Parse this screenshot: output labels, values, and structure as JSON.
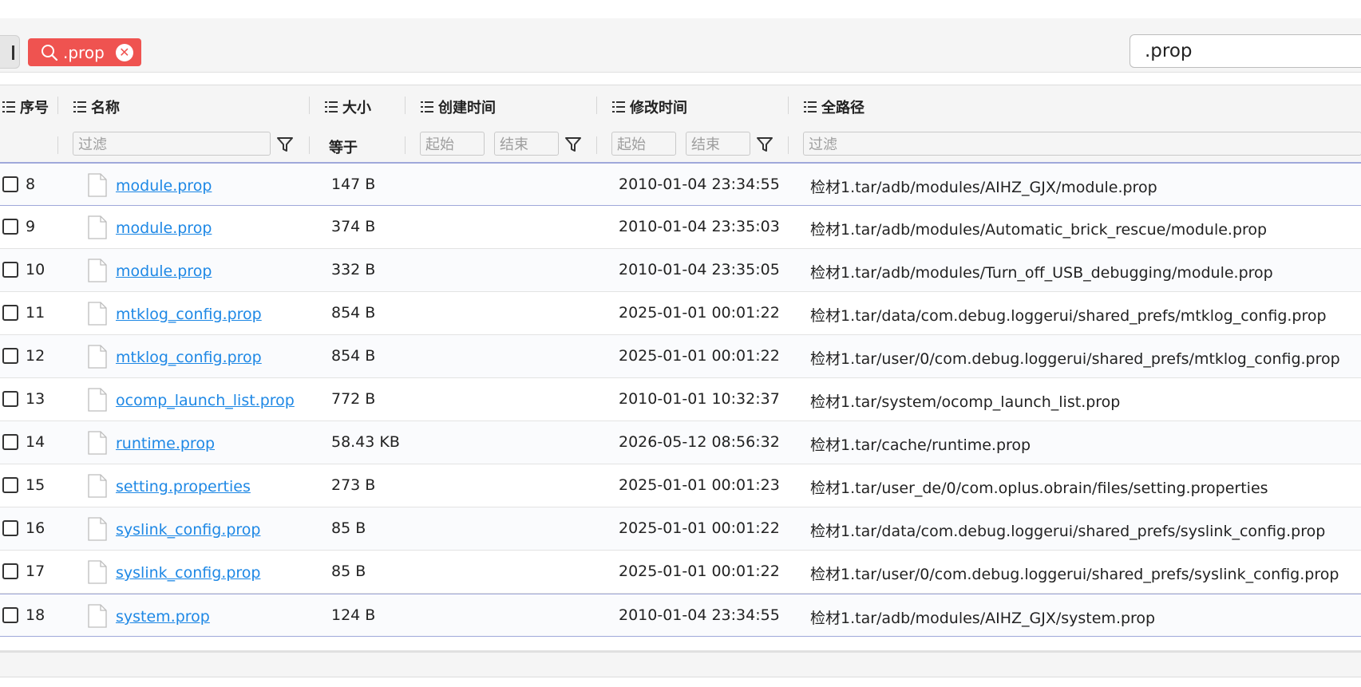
{
  "search_tag": {
    "label": ".prop",
    "icon": "search-icon",
    "close_icon": "close-icon"
  },
  "search_box": {
    "value": ".prop"
  },
  "columns": {
    "seq": "序号",
    "name": "名称",
    "size": "大小",
    "created": "创建时间",
    "modified": "修改时间",
    "path": "全路径"
  },
  "filters": {
    "name_placeholder": "过滤",
    "size_op": "等于",
    "created_start": "起始",
    "created_end": "结束",
    "modified_start": "起始",
    "modified_end": "结束",
    "path_placeholder": "过滤"
  },
  "rows": [
    {
      "seq": "8",
      "name": "module.prop",
      "size": "147 B",
      "created": "",
      "modified": "2010-01-04 23:34:55",
      "path": "检材1.tar/adb/modules/AIHZ_GJX/module.prop"
    },
    {
      "seq": "9",
      "name": "module.prop",
      "size": "374 B",
      "created": "",
      "modified": "2010-01-04 23:35:03",
      "path": "检材1.tar/adb/modules/Automatic_brick_rescue/module.prop"
    },
    {
      "seq": "10",
      "name": "module.prop",
      "size": "332 B",
      "created": "",
      "modified": "2010-01-04 23:35:05",
      "path": "检材1.tar/adb/modules/Turn_off_USB_debugging/module.prop"
    },
    {
      "seq": "11",
      "name": "mtklog_config.prop",
      "size": "854 B",
      "created": "",
      "modified": "2025-01-01 00:01:22",
      "path": "检材1.tar/data/com.debug.loggerui/shared_prefs/mtklog_config.prop"
    },
    {
      "seq": "12",
      "name": "mtklog_config.prop",
      "size": "854 B",
      "created": "",
      "modified": "2025-01-01 00:01:22",
      "path": "检材1.tar/user/0/com.debug.loggerui/shared_prefs/mtklog_config.prop"
    },
    {
      "seq": "13",
      "name": "ocomp_launch_list.prop",
      "size": "772 B",
      "created": "",
      "modified": "2010-01-01 10:32:37",
      "path": "检材1.tar/system/ocomp_launch_list.prop"
    },
    {
      "seq": "14",
      "name": "runtime.prop",
      "size": "58.43 KB",
      "created": "",
      "modified": "2026-05-12 08:56:32",
      "path": "检材1.tar/cache/runtime.prop"
    },
    {
      "seq": "15",
      "name": "setting.properties",
      "size": "273 B",
      "created": "",
      "modified": "2025-01-01 00:01:23",
      "path": "检材1.tar/user_de/0/com.oplus.obrain/files/setting.properties"
    },
    {
      "seq": "16",
      "name": "syslink_config.prop",
      "size": "85 B",
      "created": "",
      "modified": "2025-01-01 00:01:22",
      "path": "检材1.tar/data/com.debug.loggerui/shared_prefs/syslink_config.prop"
    },
    {
      "seq": "17",
      "name": "syslink_config.prop",
      "size": "85 B",
      "created": "",
      "modified": "2025-01-01 00:01:22",
      "path": "检材1.tar/user/0/com.debug.loggerui/shared_prefs/syslink_config.prop"
    },
    {
      "seq": "18",
      "name": "system.prop",
      "size": "124 B",
      "created": "",
      "modified": "2010-01-04 23:34:55",
      "path": "检材1.tar/adb/modules/AIHZ_GJX/system.prop"
    }
  ],
  "colors": {
    "accent": "#ef5350",
    "link": "#1e88e5",
    "selection_border": "#9fa8da"
  }
}
